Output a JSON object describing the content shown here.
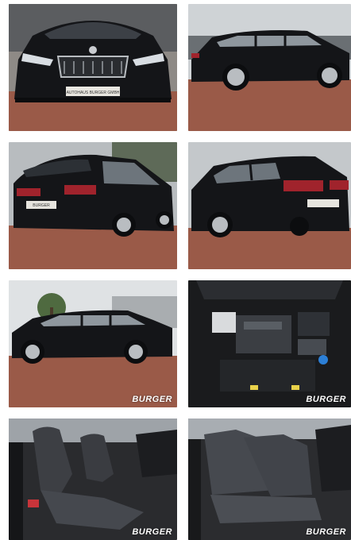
{
  "gallery": {
    "watermark": "BURGER",
    "front_plate": "AUTOHAUS BURGER GMBH",
    "rear_plate": "BURGER"
  },
  "colors": {
    "car_body": "#141518",
    "brick": "#9a5a48",
    "sky": "#cfd3d6"
  },
  "icons": [
    "car-front-photo",
    "car-side-photo",
    "car-rear-photo",
    "engine-bay-photo",
    "seat-photo"
  ]
}
